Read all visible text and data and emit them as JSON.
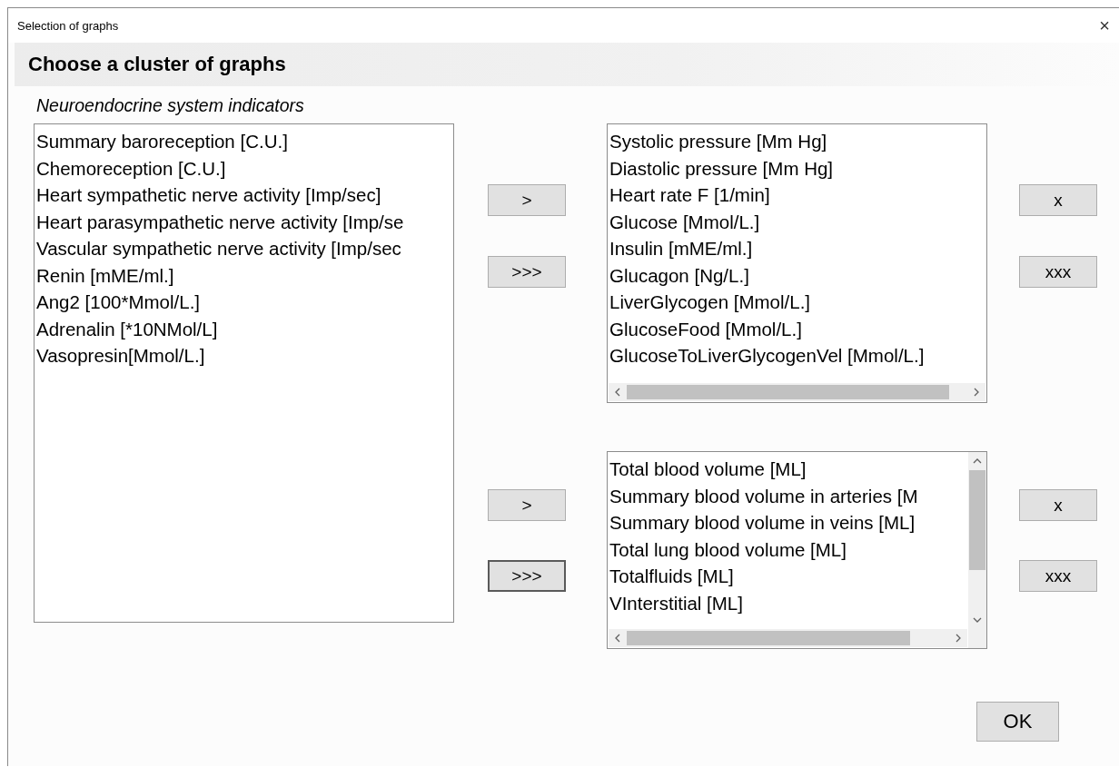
{
  "window": {
    "title": "Selection of graphs",
    "close": "×"
  },
  "header": "Choose a cluster of graphs",
  "cluster": {
    "name": "Neuroendocrine system indicators",
    "items": [
      "Summary baroreception [C.U.]",
      "Chemoreception [C.U.]",
      "Heart sympathetic nerve activity [Imp/sec]",
      "Heart parasympathetic nerve activity [Imp/se",
      "Vascular sympathetic nerve activity [Imp/sec",
      "Renin [mME/ml.]",
      "Ang2 [100*Mmol/L.]",
      "Adrenalin [*10NMol/L]",
      "Vasopresin[Mmol/L.]"
    ]
  },
  "groups": [
    {
      "add_buttons": [
        {
          "label": ">",
          "focused": false
        },
        {
          "label": ">>>",
          "focused": false
        }
      ],
      "items": [
        "Systolic pressure [Mm Hg]",
        "Diastolic pressure [Mm Hg]",
        "Heart rate F [1/min]",
        "Glucose [Mmol/L.]",
        "Insulin [mME/ml.]",
        "Glucagon [Ng/L.]",
        "LiverGlycogen [Mmol/L.]",
        "GlucoseFood [Mmol/L.]",
        "GlucoseToLiverGlycogenVel [Mmol/L.]"
      ],
      "vertical_scrollbar": false,
      "remove_buttons": [
        {
          "label": "x",
          "focused": false
        },
        {
          "label": "xxx",
          "focused": false
        }
      ]
    },
    {
      "add_buttons": [
        {
          "label": ">",
          "focused": false
        },
        {
          "label": ">>>",
          "focused": true
        }
      ],
      "items": [
        "Total blood volume [ML]",
        "Summary blood volume in arteries [M",
        "Summary blood volume in veins [ML]",
        "Total lung blood volume [ML]",
        "Totalfluids [ML]",
        "VInterstitial [ML]"
      ],
      "vertical_scrollbar": true,
      "remove_buttons": [
        {
          "label": "x",
          "focused": false
        },
        {
          "label": "xxx",
          "focused": false
        }
      ]
    }
  ],
  "ok_button": "OK"
}
